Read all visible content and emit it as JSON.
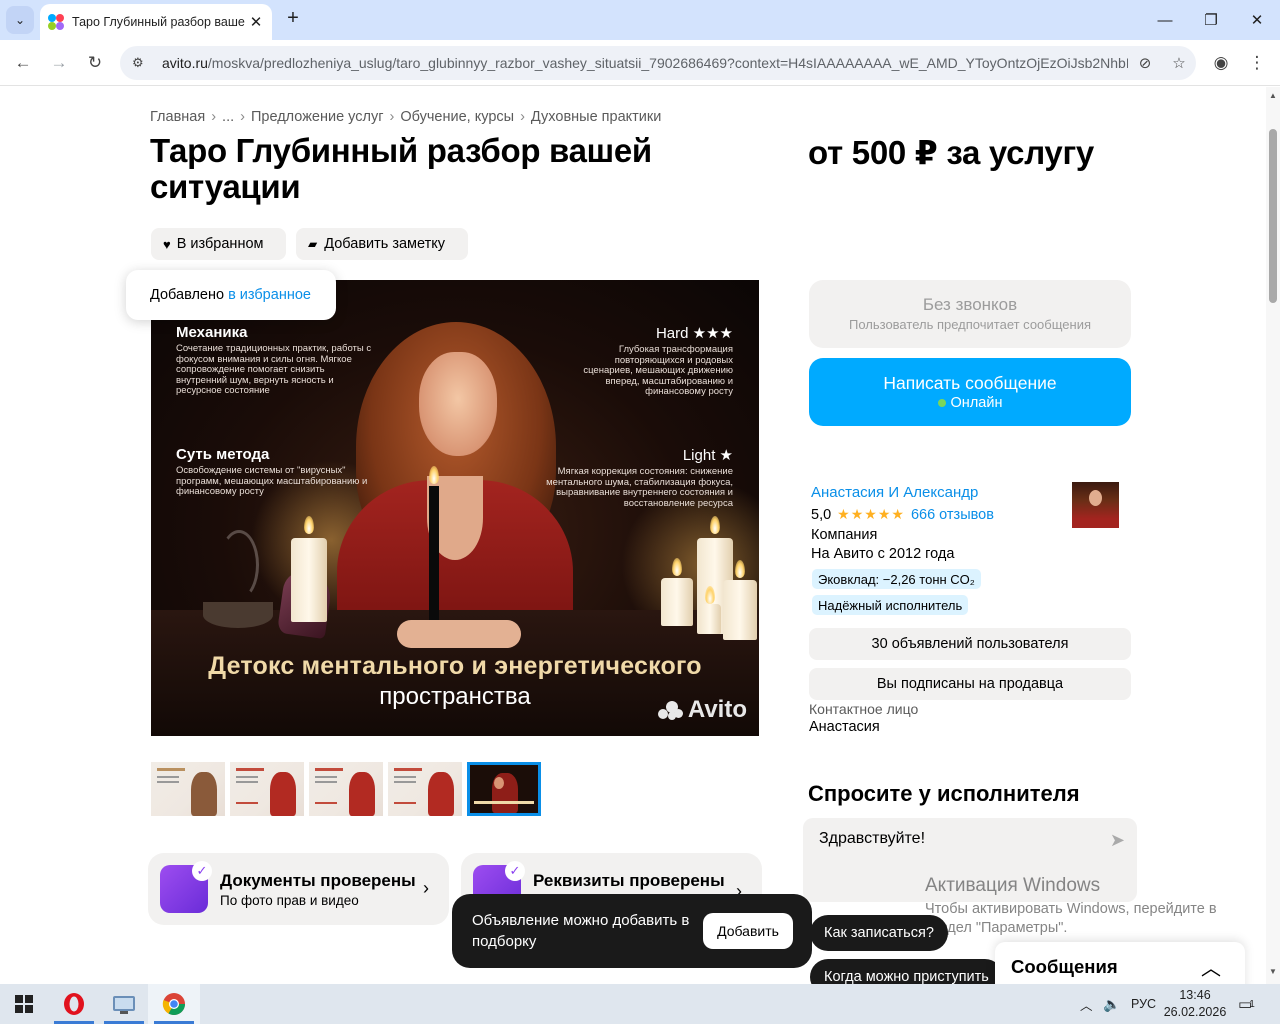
{
  "browser": {
    "tab_title": "Таро Глубинный разбор ваше",
    "url_host": "avito.ru",
    "url_path": "/moskva/predlozheniya_uslug/taro_glubinnyy_razbor_vashey_situatsii_7902686469?context=H4sIAAAAAAAA_wE_AMD_YToyOntzOjEzOiJsb2NhbFB...",
    "icons": [
      "tab-list-icon",
      "close-icon",
      "plus-icon",
      "minimize-icon",
      "restore-icon",
      "close-window-icon",
      "back-icon",
      "forward-icon",
      "reload-icon",
      "site-settings-icon",
      "eye-off-icon",
      "star-icon",
      "profile-icon",
      "menu-icon"
    ]
  },
  "breadcrumbs": [
    "Главная",
    "...",
    "Предложение услуг",
    "Обучение, курсы",
    "Духовные практики"
  ],
  "title": "Таро Глубинный разбор вашей ситуации",
  "price": "от 500 ₽ за услугу",
  "actions": {
    "favorite": "В избранном",
    "note": "Добавить заметку"
  },
  "fav_toast": {
    "prefix": "Добавлено",
    "link": "в избранное"
  },
  "image": {
    "tl_title": "Механика",
    "tl_text": "Сочетание традиционных практик, работы с фокусом внимания и силы огня. Мягкое сопровождение помогает снизить внутренний шум, вернуть ясность и ресурсное состояние",
    "tr_title": "Hard ★★★",
    "tr_text": "Глубокая трансформация повторяющихся и родовых сценариев, мешающих движению вперед, масштабированию и финансовому росту",
    "ml_title": "Суть метода",
    "ml_text": "Освобождение системы от \"вирусных\" программ, мешающих масштабированию и финансовому росту",
    "mr_title": "Light ★",
    "mr_text": "Мягкая коррекция состояния: снижение ментального шума, стабилизация фокуса, выравнивание внутреннего состояния и восстановление ресурса",
    "caption_1": "Детокс ментального и энергетического",
    "caption_2": "пространства",
    "watermark": "Avito"
  },
  "verifications": [
    {
      "title": "Документы проверены",
      "subtitle": "По фото прав и видео"
    },
    {
      "title": "Реквизиты проверены",
      "subtitle": ""
    }
  ],
  "contact_buttons": {
    "no_calls_title": "Без звонков",
    "no_calls_sub": "Пользователь предпочитает сообщения",
    "write_title": "Написать сообщение",
    "write_sub": "Онлайн"
  },
  "seller": {
    "name": "Анастасия И Александр",
    "rating": "5,0",
    "stars": "★★★★★",
    "reviews": "666 отзывов",
    "type": "Компания",
    "since": "На Авито с 2012 года",
    "eco_badge": "Эковклад: −2,26 тонн CO₂",
    "reliable_badge": "Надёжный исполнитель",
    "listings": "30 объявлений пользователя",
    "subscribed": "Вы подписаны на продавца",
    "contact_label": "Контактное лицо",
    "contact_name": "Анастасия"
  },
  "ask": {
    "heading": "Спросите у исполнителя",
    "value": "Здравствуйте!",
    "chips": [
      "Как записаться?",
      "Когда можно приступить"
    ]
  },
  "collection_toast": {
    "message": "Объявление можно добавить в подборку",
    "button": "Добавить"
  },
  "messages_panel": {
    "title": "Сообщения"
  },
  "windows_activation": {
    "title": "Активация Windows",
    "text": "Чтобы активировать Windows, перейдите в раздел \"Параметры\"."
  },
  "taskbar": {
    "lang": "РУС",
    "time": "13:46",
    "date": "26.02.2026",
    "notif_count": "1"
  }
}
